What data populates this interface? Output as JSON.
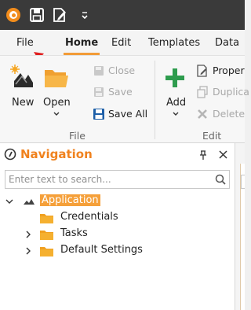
{
  "title_bar": {
    "icons": [
      "app-logo-icon",
      "save-icon",
      "edit-document-icon",
      "quick-access-dropdown-icon"
    ]
  },
  "menu": {
    "tabs": [
      {
        "label": "File"
      },
      {
        "label": "Home"
      },
      {
        "label": "Edit"
      },
      {
        "label": "Templates"
      },
      {
        "label": "Data"
      }
    ],
    "active_tab": "Home"
  },
  "ribbon": {
    "file_group": {
      "label": "File",
      "new_label": "New",
      "open_label": "Open",
      "close_label": "Close",
      "save_label": "Save",
      "save_all_label": "Save All"
    },
    "edit_group": {
      "label": "Edit",
      "add_label": "Add",
      "properties_label": "Proper",
      "duplicate_label": "Duplica",
      "delete_label": "Delete"
    }
  },
  "navigation": {
    "title": "Navigation",
    "search_placeholder": "Enter text to search...",
    "tree": {
      "root": "Application",
      "children": [
        {
          "label": "Credentials",
          "expandable": false
        },
        {
          "label": "Tasks",
          "expandable": true
        },
        {
          "label": "Default Settings",
          "expandable": true
        }
      ]
    }
  },
  "colors": {
    "accent": "#f29c38",
    "nav_title": "#f0821e",
    "add_green": "#2e9c4e",
    "save_blue": "#1d5fa8",
    "title_bar": "#3a3a3a"
  }
}
